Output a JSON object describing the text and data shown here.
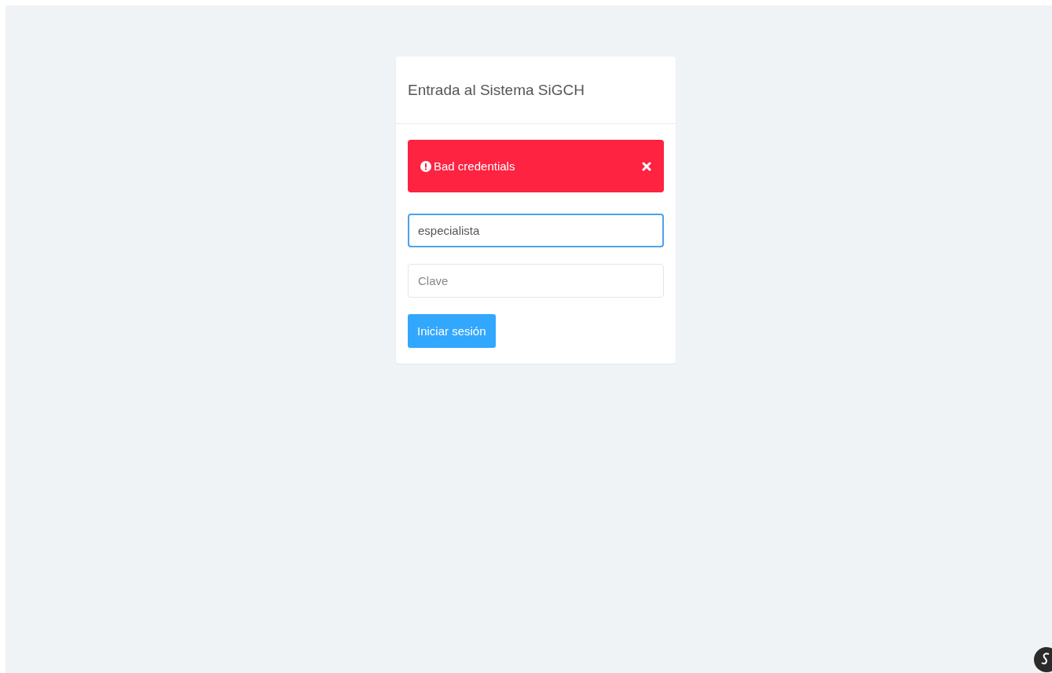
{
  "login_card": {
    "title": "Entrada al Sistema SiGCH",
    "alert": {
      "message": "Bad credentials",
      "dismissible": true
    },
    "fields": [
      {
        "kind": "text",
        "value": "especialista",
        "focused": true
      },
      {
        "kind": "password",
        "placeholder": "Clave",
        "focused": false
      }
    ],
    "submit_button": "Iniciar sesión"
  }
}
